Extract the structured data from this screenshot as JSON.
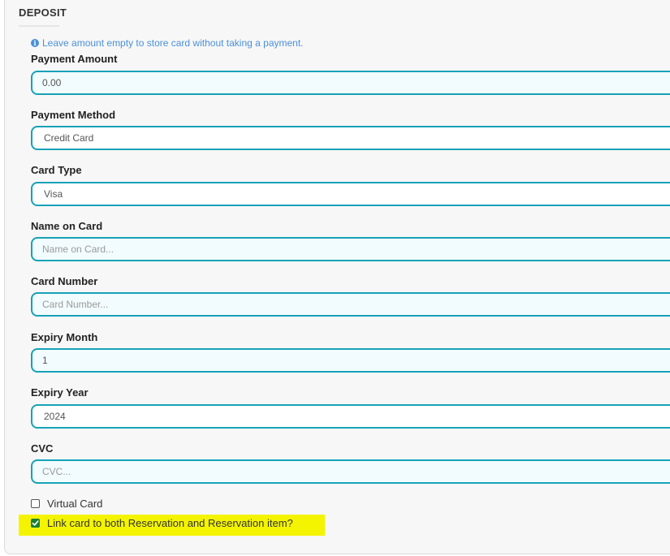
{
  "section": {
    "title": "DEPOSIT"
  },
  "info_note": "Leave amount empty to store card without taking a payment.",
  "fields": {
    "payment_amount": {
      "label": "Payment Amount",
      "value": "0.00"
    },
    "payment_method": {
      "label": "Payment Method",
      "value": "Credit Card"
    },
    "card_type": {
      "label": "Card Type",
      "value": "Visa"
    },
    "name_on_card": {
      "label": "Name on Card",
      "value": "",
      "placeholder": "Name on Card..."
    },
    "card_number": {
      "label": "Card Number",
      "value": "",
      "placeholder": "Card Number..."
    },
    "expiry_month": {
      "label": "Expiry Month",
      "value": "1"
    },
    "expiry_year": {
      "label": "Expiry Year",
      "value": "2024"
    },
    "cvc": {
      "label": "CVC",
      "value": "",
      "placeholder": "CVC..."
    }
  },
  "checkboxes": {
    "virtual_card": {
      "label": "Virtual Card",
      "checked": false
    },
    "link_card": {
      "label": "Link card to both Reservation and Reservation item?",
      "checked": true
    }
  },
  "colors": {
    "accent": "#17a2b8",
    "info": "#4a90d9",
    "checkbox_checked": "#1a7f37",
    "highlight": "#f4f400"
  },
  "icons": {
    "info": "info-circle-icon",
    "check": "check-icon"
  }
}
